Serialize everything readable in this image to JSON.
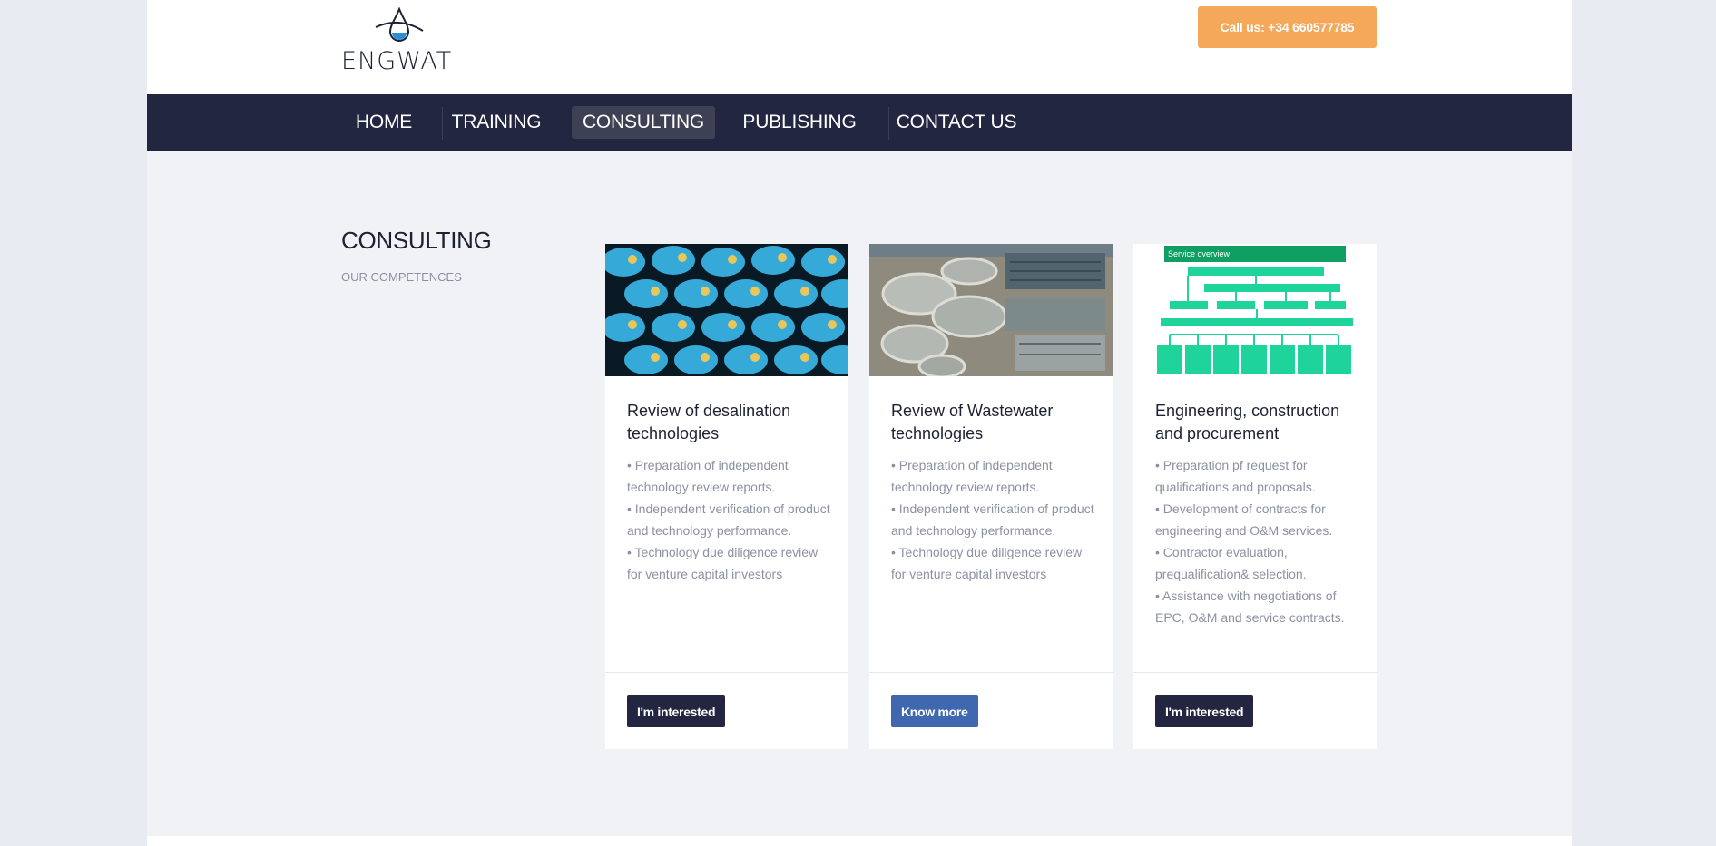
{
  "header": {
    "logo_text": "ENGWAT",
    "call_label": "Call us: +34 660577785"
  },
  "nav": {
    "items": [
      {
        "label": "HOME"
      },
      {
        "label": "TRAINING"
      },
      {
        "label": "CONSULTING",
        "active": true
      },
      {
        "label": "PUBLISHING"
      },
      {
        "label": "CONTACT US"
      }
    ]
  },
  "section": {
    "title": "CONSULTING",
    "subtitle": "OUR COMPETENCES"
  },
  "cards": [
    {
      "title": "Review of desalination technologies",
      "bullets": [
        "• Preparation of independent technology review reports.",
        "• Independent verification of product and technology performance.",
        "• Technology due diligence review for venture capital investors"
      ],
      "button": "I'm interested",
      "image": "desalination-membranes"
    },
    {
      "title": "Review of Wastewater technologies",
      "bullets": [
        "• Preparation of independent technology review reports.",
        "• Independent verification of product and technology performance.",
        "• Technology due diligence review for venture capital investors"
      ],
      "button": "Know more",
      "image": "wastewater-plant-aerial"
    },
    {
      "title": "Engineering, construction and procurement",
      "bullets": [
        "• Preparation pf request for qualifications and proposals.",
        "• Development of contracts for engineering and O&M services.",
        "• Contractor evaluation, prequalification& selection.",
        "• Assistance with negotiations of EPC, O&M and service contracts."
      ],
      "button": "I'm interested",
      "image": "service-overview-diagram",
      "image_caption": "Service overview"
    }
  ],
  "colors": {
    "nav_bg": "#222640",
    "call_button": "#f5a85a",
    "button_dark": "#222640",
    "button_blue": "#3f68b0"
  }
}
